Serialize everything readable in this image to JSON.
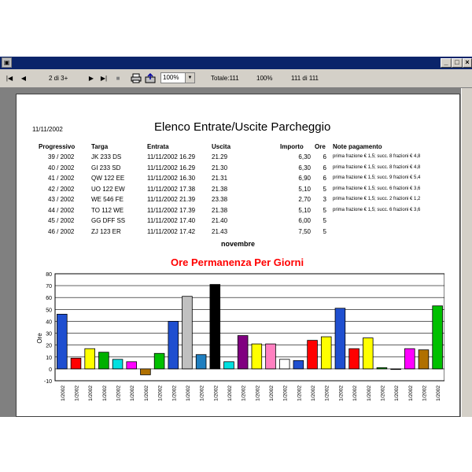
{
  "window": {
    "minimize_glyph": "_",
    "maximize_glyph": "□",
    "close_glyph": "×"
  },
  "toolbar": {
    "first_glyph": "|◀",
    "prev_glyph": "◀",
    "page_indicator": "2 di 3+",
    "next_glyph": "▶",
    "last_glyph": "▶|",
    "stop_glyph": "■",
    "print_icon": "printer-icon",
    "export_icon": "export-icon",
    "zoom_value": "100%",
    "total": "Totale:111",
    "percent": "100%",
    "record_count": "111 di 111"
  },
  "report": {
    "date": "11/11/2002",
    "title": "Elenco Entrate/Uscite Parcheggio",
    "month": "novembre",
    "headers": {
      "progressivo": "Progressivo",
      "targa": "Targa",
      "entrata": "Entrata",
      "uscita": "Uscita",
      "importo": "Importo",
      "ore": "Ore",
      "note": "Note pagamento"
    },
    "rows": [
      {
        "prog": "39 / 2002",
        "targa": "JK 233 DS",
        "entrata": "11/11/2002 16.29",
        "uscita": "21.29",
        "importo": "6,30",
        "ore": "6",
        "note": "prima frazione € 1,5; succ. 8 frazioni € 4,8"
      },
      {
        "prog": "40 / 2002",
        "targa": "GI 233 SD",
        "entrata": "11/11/2002 16.29",
        "uscita": "21.30",
        "importo": "6,30",
        "ore": "6",
        "note": "prima frazione € 1,5; succ. 8 frazioni € 4,8"
      },
      {
        "prog": "41 / 2002",
        "targa": "QW 122 EE",
        "entrata": "11/11/2002 16.30",
        "uscita": "21.31",
        "importo": "6,90",
        "ore": "6",
        "note": "prima frazione € 1,5; succ. 9 frazioni € 5,4"
      },
      {
        "prog": "42 / 2002",
        "targa": "UO 122 EW",
        "entrata": "11/11/2002 17.38",
        "uscita": "21.38",
        "importo": "5,10",
        "ore": "5",
        "note": "prima frazione € 1,5; succ. 6 frazioni € 3,6"
      },
      {
        "prog": "43 / 2002",
        "targa": "WE 546 FE",
        "entrata": "11/11/2002 21.39",
        "uscita": "23.38",
        "importo": "2,70",
        "ore": "3",
        "note": "prima frazione € 1,5; succ. 2 frazioni € 1,2"
      },
      {
        "prog": "44 / 2002",
        "targa": "TO 112 WE",
        "entrata": "11/11/2002 17.39",
        "uscita": "21.38",
        "importo": "5,10",
        "ore": "5",
        "note": "prima frazione € 1,5; succ. 6 frazioni € 3,6"
      },
      {
        "prog": "45 / 2002",
        "targa": "GG DFF SS",
        "entrata": "11/11/2002 17.40",
        "uscita": "21.40",
        "importo": "6,00",
        "ore": "5",
        "note": ""
      },
      {
        "prog": "46 / 2002",
        "targa": "ZJ 123 ER",
        "entrata": "11/11/2002 17.42",
        "uscita": "21.43",
        "importo": "7,50",
        "ore": "5",
        "note": ""
      }
    ]
  },
  "chart_data": {
    "type": "bar",
    "title": "Ore Permanenza Per Giorni",
    "ylabel": "Ore",
    "xlabel": "",
    "ylim": [
      -10,
      80
    ],
    "yticks": [
      -10,
      0,
      10,
      20,
      30,
      40,
      50,
      60,
      70,
      80
    ],
    "grid": true,
    "category_label": "1/2002",
    "values": [
      46,
      9,
      17,
      14,
      8,
      6,
      -5,
      13,
      40,
      61,
      12,
      71,
      6,
      28,
      21,
      21,
      8,
      7,
      24,
      27,
      51,
      17,
      26,
      1,
      0,
      17,
      16,
      53
    ],
    "colors": [
      "#1f4fd0",
      "#ff0000",
      "#ffff00",
      "#00b000",
      "#00e0e0",
      "#ff00ff",
      "#b07000",
      "#00c000",
      "#1f4fd0",
      "#c0c0c0",
      "#1f7fc0",
      "#000000",
      "#00e0e0",
      "#800080",
      "#ffff00",
      "#ff80c0",
      "#ffffff",
      "#1f4fd0",
      "#ff0000",
      "#ffff00",
      "#1f4fd0",
      "#ff0000",
      "#ffff00",
      "#00b000",
      "#00e0e0",
      "#ff00ff",
      "#b07000",
      "#00c000"
    ]
  }
}
